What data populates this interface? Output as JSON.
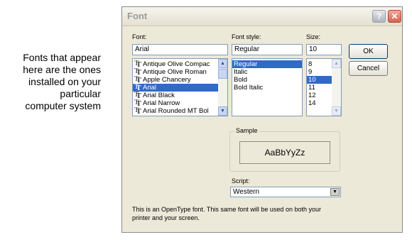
{
  "caption": {
    "lines": [
      "Fonts that appear",
      "here are the ones",
      "installed on your",
      "particular",
      "computer system"
    ]
  },
  "dialog": {
    "title": "Font",
    "help_glyph": "?",
    "close_glyph": "✕"
  },
  "font": {
    "label": "Font:",
    "value": "Arial",
    "items": [
      "Antique Olive Compac",
      "Antique Olive Roman",
      "Apple Chancery",
      "Arial",
      "Arial Black",
      "Arial Narrow",
      "Arial Rounded MT Bol"
    ],
    "selected": "Arial"
  },
  "style": {
    "label": "Font style:",
    "value": "Regular",
    "items": [
      "Regular",
      "Italic",
      "Bold",
      "Bold Italic"
    ],
    "selected": "Regular"
  },
  "size": {
    "label": "Size:",
    "value": "10",
    "items": [
      "8",
      "9",
      "10",
      "11",
      "12",
      "14"
    ],
    "selected": "10"
  },
  "buttons": {
    "ok": "OK",
    "cancel": "Cancel"
  },
  "sample": {
    "label": "Sample",
    "text": "AaBbYyZz"
  },
  "script": {
    "label": "Script:",
    "value": "Western"
  },
  "description": {
    "lines": [
      "This is an OpenType font. This same font will be used on both your",
      "printer and your screen."
    ]
  },
  "icons": {
    "font_type": "truetype-font-icon",
    "scroll_up": "scroll-up-arrow-icon",
    "scroll_down": "scroll-down-arrow-icon",
    "dropdown": "dropdown-arrow-icon"
  },
  "colors": {
    "dialog_bg": "#ece9d8",
    "selection": "#316ac5",
    "close_button": "#d8634f",
    "field_border": "#7f9db9"
  }
}
